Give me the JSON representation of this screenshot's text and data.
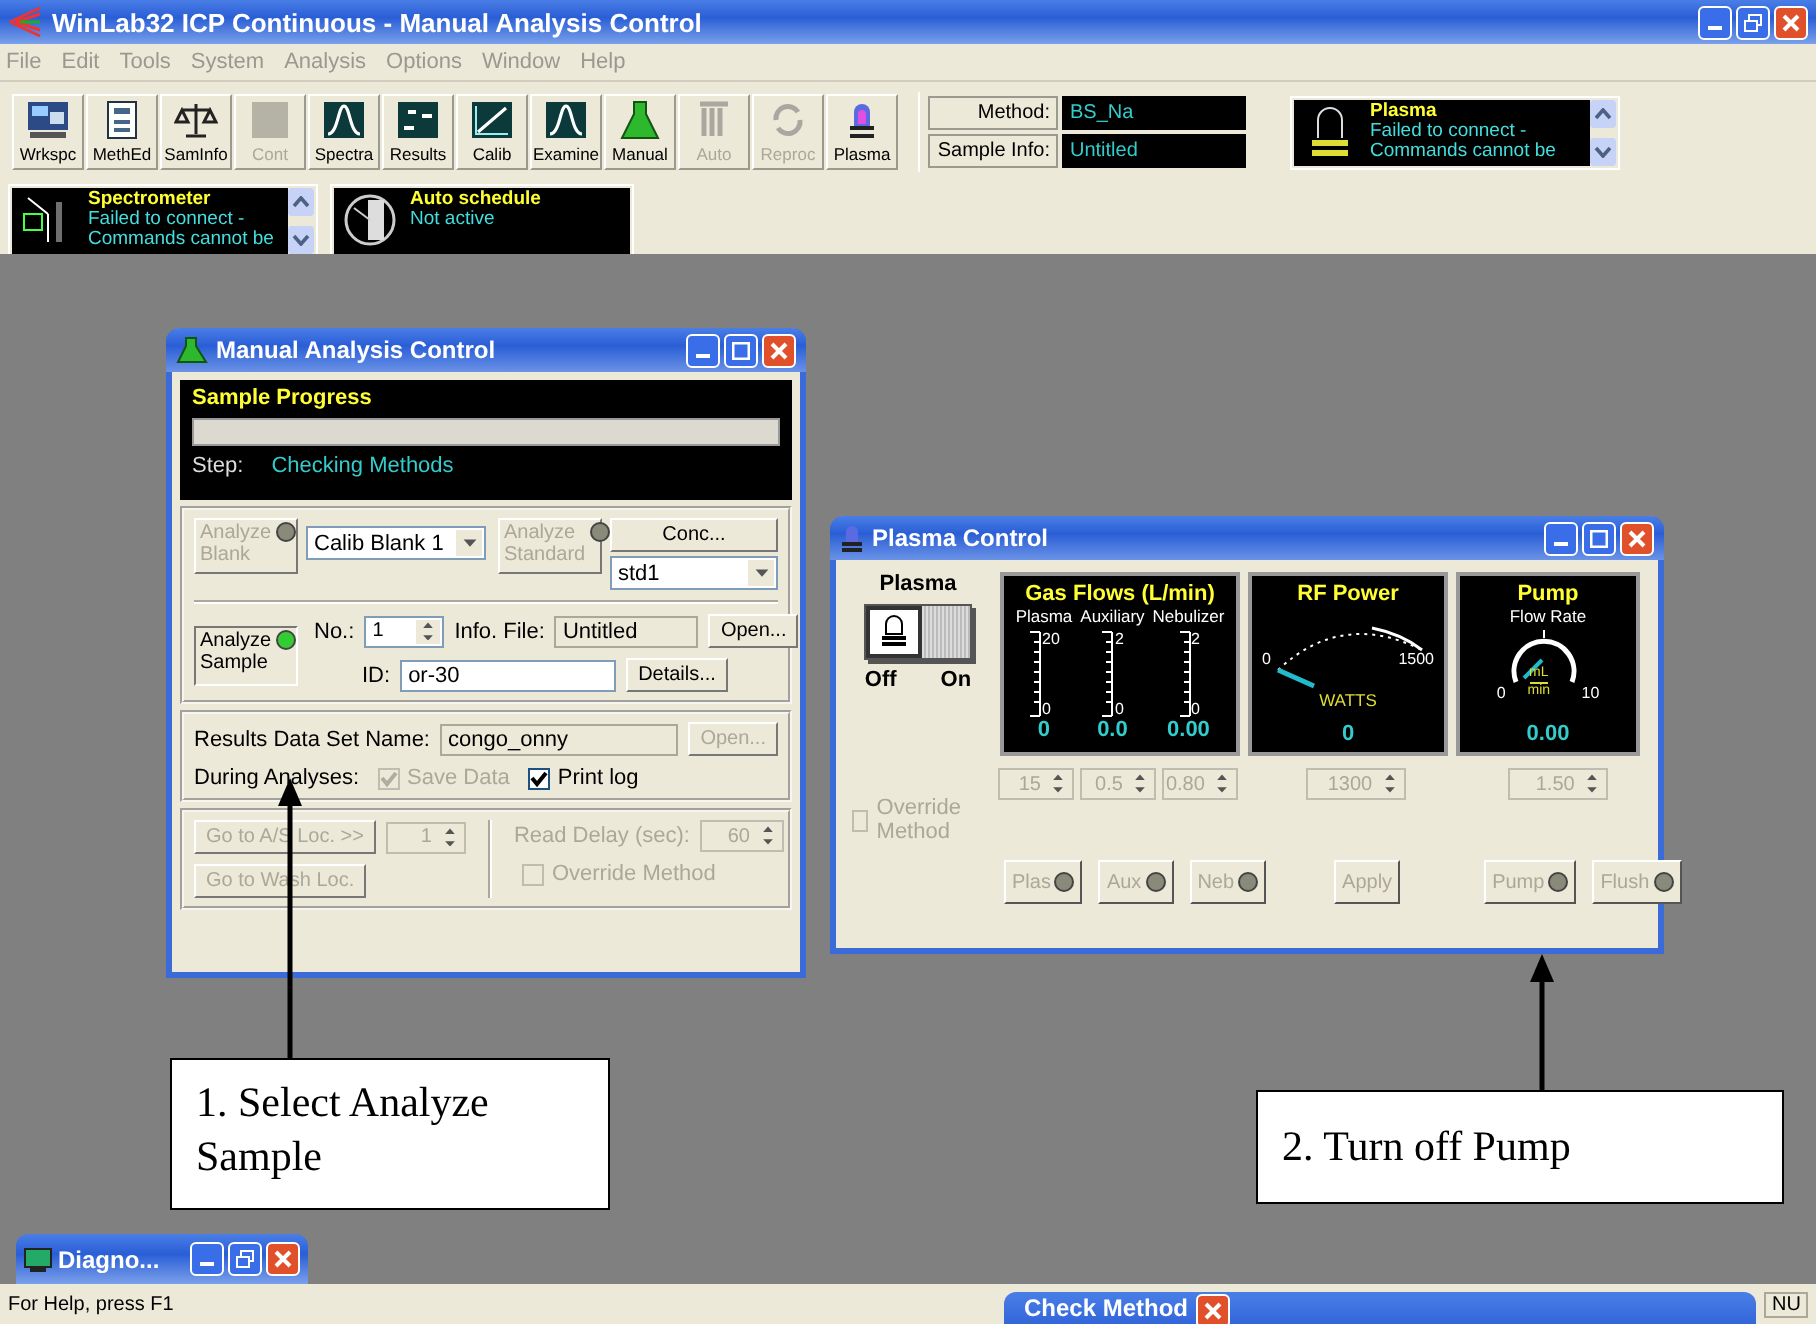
{
  "window": {
    "title": "WinLab32 ICP Continuous - Manual Analysis Control"
  },
  "menu": [
    "File",
    "Edit",
    "Tools",
    "System",
    "Analysis",
    "Options",
    "Window",
    "Help"
  ],
  "toolbar": [
    {
      "label": "Wrkspc",
      "kind": "workspace",
      "disabled": false
    },
    {
      "label": "MethEd",
      "kind": "method",
      "disabled": false
    },
    {
      "label": "SamInfo",
      "kind": "balance",
      "disabled": false
    },
    {
      "label": "Cont",
      "kind": "blank",
      "disabled": true
    },
    {
      "label": "Spectra",
      "kind": "peak",
      "disabled": false
    },
    {
      "label": "Results",
      "kind": "numbers",
      "disabled": false
    },
    {
      "label": "Calib",
      "kind": "calib",
      "disabled": false
    },
    {
      "label": "Examine",
      "kind": "peak",
      "disabled": false
    },
    {
      "label": "Manual",
      "kind": "flask",
      "disabled": false
    },
    {
      "label": "Auto",
      "kind": "bars",
      "disabled": true
    },
    {
      "label": "Reproc",
      "kind": "cycle",
      "disabled": true
    },
    {
      "label": "Plasma",
      "kind": "torch",
      "disabled": false
    }
  ],
  "method_box": {
    "method_label": "Method:",
    "method": "BS_Na",
    "sample_info_label": "Sample Info:",
    "sample_info": "Untitled"
  },
  "status_panels": [
    {
      "kind": "plasma",
      "title": "Plasma",
      "lines": [
        "Failed to connect -",
        "Commands cannot be"
      ],
      "scroll": true
    },
    {
      "kind": "spectrometer",
      "title": "Spectrometer",
      "lines": [
        "Failed to connect -",
        "Commands cannot be"
      ],
      "scroll": true
    },
    {
      "kind": "schedule",
      "title": "Auto schedule",
      "lines": [
        "Not active"
      ],
      "scroll": false
    }
  ],
  "manual_window": {
    "title": "Manual Analysis Control",
    "progress": {
      "title": "Sample Progress",
      "level": 0,
      "step_label": "Step:",
      "step": "Checking Methods"
    },
    "blank": {
      "label": "Analyze Blank",
      "lit": false,
      "disabled": true,
      "choice": "Calib Blank 1"
    },
    "standard": {
      "label": "Analyze Standard",
      "lit": false,
      "disabled": true,
      "conc": "Conc...",
      "choice": "std1"
    },
    "sample": {
      "label": "Analyze Sample",
      "lit": true,
      "disabled": false,
      "no_label": "No.:",
      "no": "1",
      "info_label": "Info. File:",
      "info": "Untitled",
      "open": "Open...",
      "id_label": "ID:",
      "id": "or-30",
      "details": "Details..."
    },
    "results": {
      "label": "Results Data Set Name:",
      "value": "congo_onny",
      "open": "Open..."
    },
    "during": {
      "label": "During Analyses:",
      "options": [
        {
          "label": "Save Data",
          "checked": true,
          "disabled": true
        },
        {
          "label": "Print log",
          "checked": true,
          "disabled": false
        }
      ]
    },
    "autosampler": {
      "goto": "Go to A/S Loc. >>",
      "loc": "1",
      "wash": "Go to Wash Loc.",
      "delay_label": "Read Delay (sec):",
      "delay": "60",
      "override": {
        "label": "Override Method",
        "checked": false,
        "disabled": true
      }
    }
  },
  "plasma_window": {
    "title": "Plasma Control",
    "switch": {
      "label": "Plasma",
      "off": "Off",
      "on_label": "On",
      "on": false
    },
    "gas": {
      "title": "Gas Flows (L/min)",
      "gauges": [
        {
          "label": "Plasma",
          "max": "20",
          "min": "0",
          "value": "0",
          "setpoint": "15"
        },
        {
          "label": "Auxiliary",
          "max": "2",
          "min": "0",
          "value": "0.0",
          "setpoint": "0.5"
        },
        {
          "label": "Nebulizer",
          "max": "2",
          "min": "0",
          "value": "0.00",
          "setpoint": "0.80"
        }
      ]
    },
    "rf": {
      "title": "RF Power",
      "min": "0",
      "max": "1500",
      "unit": "WATTS",
      "value": "0",
      "setpoint": "1300"
    },
    "pump": {
      "title": "Pump",
      "subtitle": "Flow Rate",
      "min": "0",
      "max": "10",
      "unit_top": "mL",
      "unit_bottom": "min",
      "value": "0.00",
      "setpoint": "1.50"
    },
    "override": {
      "label": "Override Method",
      "checked": false,
      "disabled": true
    },
    "buttons": [
      {
        "label": "Plas",
        "lit": false
      },
      {
        "label": "Aux",
        "lit": false
      },
      {
        "label": "Neb",
        "lit": false
      },
      {
        "label": "Apply"
      },
      {
        "label": "Pump",
        "lit": false
      },
      {
        "label": "Flush",
        "lit": false
      }
    ]
  },
  "callouts": [
    {
      "text": "1. Select Analyze Sample"
    },
    {
      "text": "2. Turn off Pump"
    }
  ],
  "minimized": {
    "title": "Diagno..."
  },
  "check_window": {
    "title": "Check Method"
  },
  "status_bar": {
    "help": "For Help, press F1",
    "num": "NU"
  }
}
